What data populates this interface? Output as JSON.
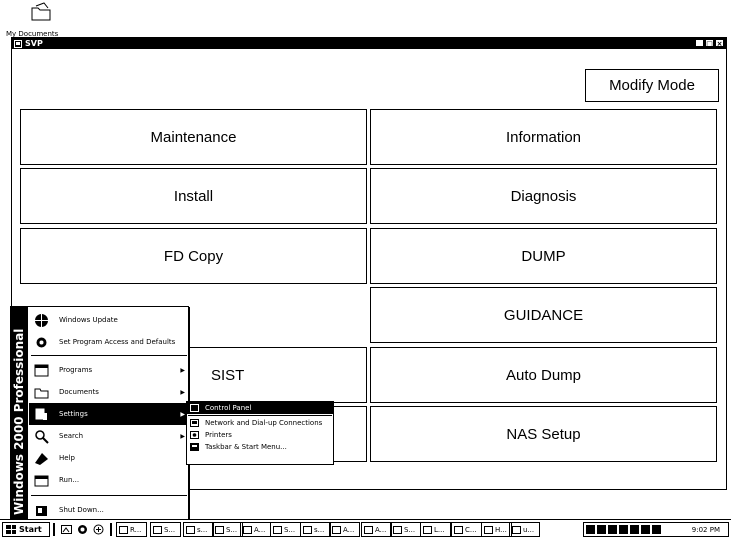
{
  "desktop": {
    "icon_label": "My Documents"
  },
  "window": {
    "title": "SVP",
    "controls": [
      "_",
      "□",
      "×"
    ],
    "modify_mode": "Modify Mode",
    "buttons_left": [
      "Maintenance",
      "Install",
      "FD Copy",
      "",
      "SIST",
      ""
    ],
    "buttons_right": [
      "Information",
      "Diagnosis",
      "DUMP",
      "GUIDANCE",
      "Auto Dump",
      "NAS Setup"
    ]
  },
  "start_menu": {
    "banner": "Windows 2000 Professional",
    "items": [
      {
        "label": "Windows Update",
        "icon": "globe-icon"
      },
      {
        "label": "Set Program Access and Defaults",
        "icon": "gear-icon"
      },
      {
        "label": "Programs",
        "icon": "programs-icon",
        "arrow": "▶"
      },
      {
        "label": "Documents",
        "icon": "folder-icon",
        "arrow": "▶"
      },
      {
        "label": "Settings",
        "icon": "settings-icon",
        "arrow": "▶"
      },
      {
        "label": "Search",
        "icon": "search-icon",
        "arrow": "▶"
      },
      {
        "label": "Help",
        "icon": "help-icon"
      },
      {
        "label": "Run...",
        "icon": "run-icon"
      },
      {
        "label": "Shut Down...",
        "icon": "shutdown-icon"
      }
    ]
  },
  "settings_submenu": {
    "items": [
      "Control Panel",
      "Network and Dial-up Connections",
      "Printers",
      "Taskbar & Start Menu..."
    ]
  },
  "taskbar": {
    "start_label": "Start",
    "tasks": [
      "R...",
      "S...",
      "s...",
      "S...",
      "A...",
      "S...",
      "s...",
      "A...",
      "A...",
      "S...",
      "L...",
      "C...",
      "H...",
      "u..."
    ],
    "clock": "9:02 PM"
  }
}
